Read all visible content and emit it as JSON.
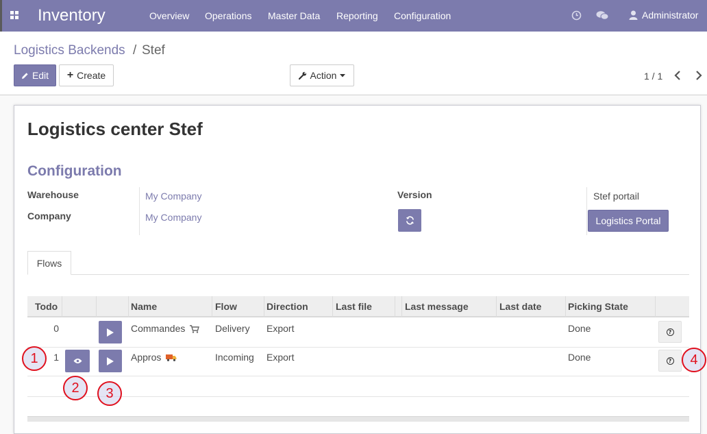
{
  "navbar": {
    "brand": "Inventory",
    "menu": [
      "Overview",
      "Operations",
      "Master Data",
      "Reporting",
      "Configuration"
    ],
    "user": "Administrator",
    "icons": [
      "apps-icon",
      "clock-icon",
      "chat-icon",
      "user-icon"
    ]
  },
  "breadcrumb": {
    "parent": "Logistics Backends",
    "separator": "/",
    "current": "Stef"
  },
  "toolbar": {
    "edit_label": "Edit",
    "create_label": "Create",
    "action_label": "Action"
  },
  "pager": {
    "value": "1 / 1"
  },
  "record": {
    "title": "Logistics center Stef",
    "section": "Configuration",
    "warehouse_label": "Warehouse",
    "warehouse_value": "My Company",
    "company_label": "Company",
    "company_value": "My Company",
    "version_label": "Version",
    "version_value": "Stef portail",
    "portal_button": "Logistics Portal"
  },
  "tabs": [
    "Flows"
  ],
  "table": {
    "columns": [
      "Todo",
      "",
      "",
      "Name",
      "Flow",
      "Direction",
      "Last file",
      "",
      "Last message",
      "Last date",
      "Picking State",
      ""
    ],
    "rows": [
      {
        "todo": "0",
        "name": "Commandes",
        "name_icon": "cart-icon",
        "flow": "Delivery",
        "direction": "Export",
        "last_file": "",
        "last_message": "",
        "last_date": "",
        "picking_state": "Done"
      },
      {
        "todo": "1",
        "name": "Appros",
        "name_icon": "truck-icon",
        "flow": "Incoming",
        "direction": "Export",
        "last_file": "",
        "last_message": "",
        "last_date": "",
        "picking_state": "Done"
      }
    ]
  },
  "callouts": [
    "1",
    "2",
    "3",
    "4"
  ],
  "colors": {
    "primary": "#7c7bad",
    "callout": "#e0101e"
  }
}
